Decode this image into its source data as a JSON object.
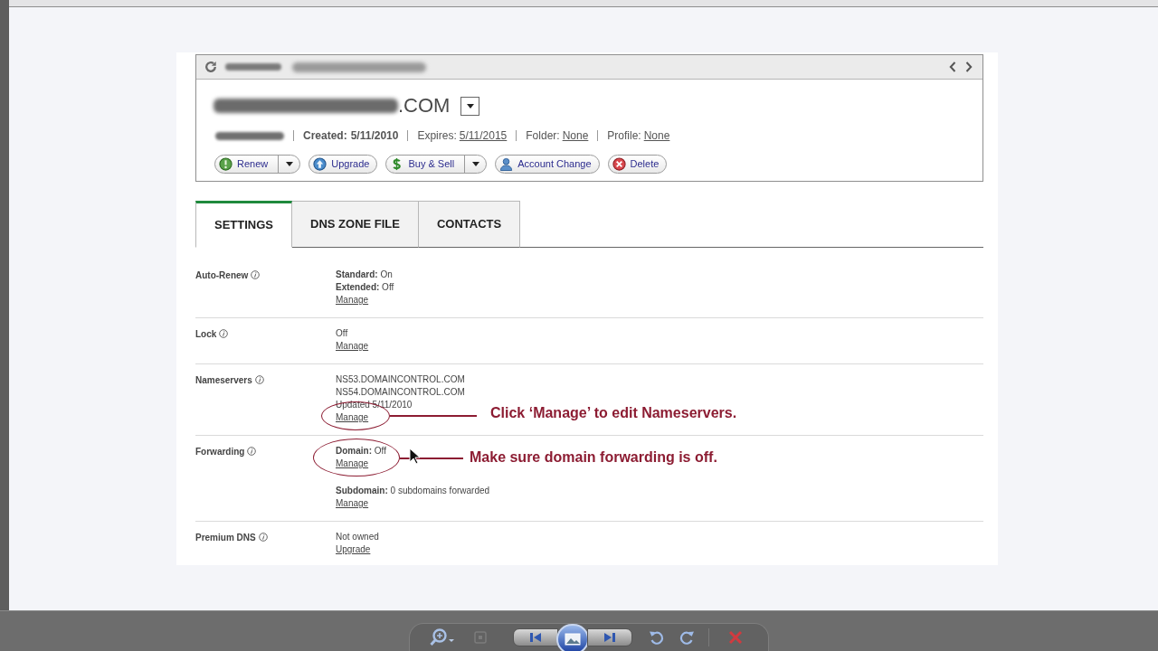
{
  "domain": {
    "name_visible": ".COM"
  },
  "details": [
    {
      "label": "Created:",
      "value": "5/11/2010",
      "kind": "text"
    },
    {
      "label": "Expires:",
      "value": "5/11/2015",
      "kind": "link"
    },
    {
      "label": "Folder:",
      "value": "None",
      "kind": "link"
    },
    {
      "label": "Profile:",
      "value": "None",
      "kind": "link"
    }
  ],
  "actions": [
    {
      "label": "Renew",
      "has_menu": true
    },
    {
      "label": "Upgrade",
      "has_menu": false
    },
    {
      "label": "Buy & Sell",
      "has_menu": true
    },
    {
      "label": "Account Change",
      "has_menu": false
    },
    {
      "label": "Delete",
      "has_menu": false
    }
  ],
  "tabs": [
    {
      "label": "SETTINGS",
      "selected": true
    },
    {
      "label": "DNS ZONE FILE",
      "selected": false
    },
    {
      "label": "CONTACTS",
      "selected": false
    }
  ],
  "settings": [
    {
      "label": "Auto-Renew",
      "groups": [
        {
          "lines": [
            "**Standard:** On",
            "**Extended:** Off"
          ],
          "link": "Manage"
        }
      ]
    },
    {
      "label": "Lock",
      "groups": [
        {
          "lines": [
            "Off"
          ],
          "link": "Manage"
        }
      ]
    },
    {
      "label": "Nameservers",
      "groups": [
        {
          "lines": [
            "NS53.DOMAINCONTROL.COM",
            "NS54.DOMAINCONTROL.COM",
            "Updated 5/11/2010"
          ],
          "link": "Manage",
          "callout": "Click ‘Manage’ to edit Nameservers."
        }
      ]
    },
    {
      "label": "Forwarding",
      "groups": [
        {
          "lines": [
            "**Domain:** Off"
          ],
          "link": "Manage",
          "callout": "Make sure domain forwarding is off."
        },
        {
          "lines": [
            "**Subdomain:** 0 subdomains forwarded"
          ],
          "link": "Manage"
        }
      ]
    },
    {
      "label": "Premium DNS",
      "groups": [
        {
          "lines": [
            "Not owned"
          ],
          "link": "Upgrade"
        }
      ]
    }
  ]
}
